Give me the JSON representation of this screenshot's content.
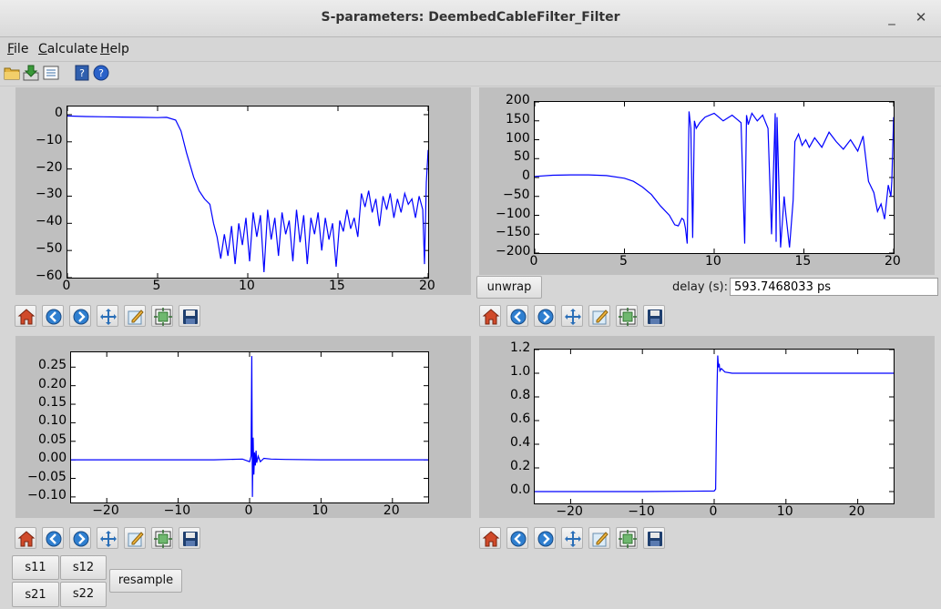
{
  "window": {
    "title": "S-parameters: DeembedCableFilter_Filter",
    "minimize": "_",
    "close": "✕"
  },
  "menu": [
    {
      "label": "File",
      "mnemonic": "F",
      "rest": "ile"
    },
    {
      "label": "Calculate",
      "mnemonic": "C",
      "rest": "alculate"
    },
    {
      "label": "Help",
      "mnemonic": "H",
      "rest": "elp"
    }
  ],
  "toolbar": [
    "open-folder-icon",
    "save-download-icon",
    "list-icon",
    "help-book-icon",
    "help-circle-icon"
  ],
  "phase": {
    "unwrap_label": "unwrap",
    "delay_label": "delay (s):",
    "delay_value": "593.7468033 ps"
  },
  "sparams": {
    "s11": "s11",
    "s12": "s12",
    "s21": "s21",
    "s22": "s22",
    "resample": "resample"
  },
  "colors": {
    "trace": "#0000ff",
    "figure_bg": "#bfbfbf"
  },
  "nav_toolbar": [
    "home-icon",
    "back-icon",
    "forward-icon",
    "pan-icon",
    "edit-axis-icon",
    "configure-subplots-icon",
    "save-figure-icon"
  ],
  "chart_data": [
    {
      "type": "line",
      "name": "magnitude",
      "xlim": [
        0,
        20
      ],
      "ylim": [
        -60,
        3
      ],
      "xticks": [
        "0",
        "5",
        "10",
        "15",
        "20"
      ],
      "yticks": [
        "0",
        "−10",
        "−20",
        "−30",
        "−40",
        "−50",
        "−60"
      ],
      "x": [
        0,
        1,
        2,
        3,
        4,
        5,
        5.5,
        6,
        6.3,
        6.6,
        7,
        7.3,
        7.6,
        7.9,
        8.1,
        8.3,
        8.5,
        8.7,
        8.9,
        9.1,
        9.3,
        9.5,
        9.7,
        9.9,
        10.1,
        10.3,
        10.5,
        10.7,
        10.9,
        11.1,
        11.3,
        11.5,
        11.7,
        11.9,
        12.1,
        12.3,
        12.5,
        12.7,
        12.9,
        13.1,
        13.3,
        13.5,
        13.7,
        13.9,
        14.1,
        14.3,
        14.5,
        14.7,
        14.9,
        15.1,
        15.3,
        15.5,
        15.7,
        15.9,
        16.1,
        16.3,
        16.5,
        16.7,
        16.9,
        17.1,
        17.3,
        17.5,
        17.7,
        17.9,
        18.1,
        18.3,
        18.5,
        18.7,
        18.9,
        19.1,
        19.3,
        19.5,
        19.7,
        19.8,
        19.9,
        20
      ],
      "y": [
        -0.5,
        -0.7,
        -0.8,
        -0.9,
        -1,
        -1.1,
        -1,
        -2,
        -6,
        -14,
        -23,
        -28,
        -31,
        -33,
        -40,
        -45,
        -53,
        -44,
        -52,
        -41,
        -55,
        -40,
        -48,
        -38,
        -54,
        -36,
        -45,
        -37,
        -58,
        -35,
        -46,
        -38,
        -52,
        -36,
        -44,
        -39,
        -54,
        -35,
        -47,
        -37,
        -55,
        -38,
        -44,
        -36,
        -50,
        -38,
        -46,
        -40,
        -56,
        -39,
        -43,
        -35,
        -42,
        -38,
        -45,
        -29,
        -34,
        -28,
        -36,
        -31,
        -41,
        -30,
        -35,
        -29,
        -38,
        -31,
        -36,
        -29,
        -33,
        -31,
        -38,
        -30,
        -35,
        -55,
        -25,
        -13
      ]
    },
    {
      "type": "line",
      "name": "phase",
      "xlim": [
        0,
        20
      ],
      "ylim": [
        -200,
        200
      ],
      "xticks": [
        "0",
        "5",
        "10",
        "15",
        "20"
      ],
      "yticks": [
        "200",
        "150",
        "100",
        "50",
        "0",
        "−50",
        "−100",
        "−150",
        "−200"
      ],
      "x": [
        0,
        1,
        2,
        3,
        4,
        5,
        5.5,
        6,
        6.5,
        7,
        7.5,
        7.8,
        8.0,
        8.1,
        8.2,
        8.3,
        8.35,
        8.4,
        8.5,
        8.6,
        8.7,
        8.8,
        8.9,
        9.0,
        9.2,
        9.5,
        10,
        10.5,
        11,
        11.5,
        11.7,
        11.8,
        11.9,
        12.1,
        12.4,
        12.7,
        13,
        13.2,
        13.4,
        13.45,
        13.5,
        13.7,
        13.9,
        14,
        14.2,
        14.4,
        14.5,
        14.7,
        14.9,
        15.1,
        15.3,
        15.6,
        16,
        16.4,
        16.8,
        17.2,
        17.6,
        18.0,
        18.3,
        18.6,
        18.9,
        19.1,
        19.3,
        19.5,
        19.7,
        19.85,
        19.9,
        20
      ],
      "y": [
        3,
        6,
        7,
        7,
        5,
        -2,
        -10,
        -25,
        -45,
        -75,
        -100,
        -125,
        -128,
        -118,
        -108,
        -112,
        -122,
        -135,
        -175,
        175,
        130,
        -160,
        150,
        130,
        145,
        160,
        170,
        150,
        165,
        145,
        -175,
        165,
        140,
        170,
        150,
        165,
        130,
        -150,
        170,
        -170,
        160,
        -185,
        -50,
        -100,
        -185,
        -60,
        95,
        115,
        85,
        100,
        80,
        105,
        80,
        120,
        95,
        75,
        100,
        70,
        110,
        -10,
        -40,
        -90,
        -70,
        -110,
        -20,
        -50,
        -10,
        160
      ]
    },
    {
      "type": "line",
      "name": "impulse_response",
      "xlim": [
        -25,
        25
      ],
      "ylim": [
        -0.115,
        0.29
      ],
      "xticks": [
        "−20",
        "−10",
        "0",
        "10",
        "20"
      ],
      "yticks": [
        "0.25",
        "0.20",
        "0.15",
        "0.10",
        "0.05",
        "0.00",
        "−0.05",
        "−0.10"
      ],
      "x": [
        -25,
        -15,
        -5,
        -1,
        0,
        0.2,
        0.3,
        0.4,
        0.5,
        0.6,
        0.7,
        0.8,
        0.9,
        1.0,
        1.2,
        1.5,
        2,
        3,
        5,
        10,
        15,
        25
      ],
      "y": [
        0,
        0,
        0,
        0.002,
        -0.005,
        0.01,
        0.28,
        -0.1,
        0.06,
        -0.04,
        0.02,
        -0.015,
        0.025,
        -0.008,
        0.01,
        -0.005,
        0.004,
        0.002,
        0.001,
        0,
        0,
        0
      ]
    },
    {
      "type": "line",
      "name": "step_response",
      "xlim": [
        -25,
        25
      ],
      "ylim": [
        -0.1,
        1.2
      ],
      "xticks": [
        "−20",
        "−10",
        "0",
        "10",
        "20"
      ],
      "yticks": [
        "1.2",
        "1.0",
        "0.8",
        "0.6",
        "0.4",
        "0.2",
        "0.0"
      ],
      "x": [
        -25,
        -10,
        0,
        0.2,
        0.3,
        0.4,
        0.5,
        0.6,
        0.7,
        0.8,
        1.0,
        1.5,
        2.5,
        5,
        25
      ],
      "y": [
        0,
        0,
        0.005,
        0.02,
        0.5,
        0.9,
        1.15,
        1.05,
        1.08,
        1.02,
        1.04,
        1.01,
        1.0,
        1.0,
        1.0
      ]
    }
  ]
}
